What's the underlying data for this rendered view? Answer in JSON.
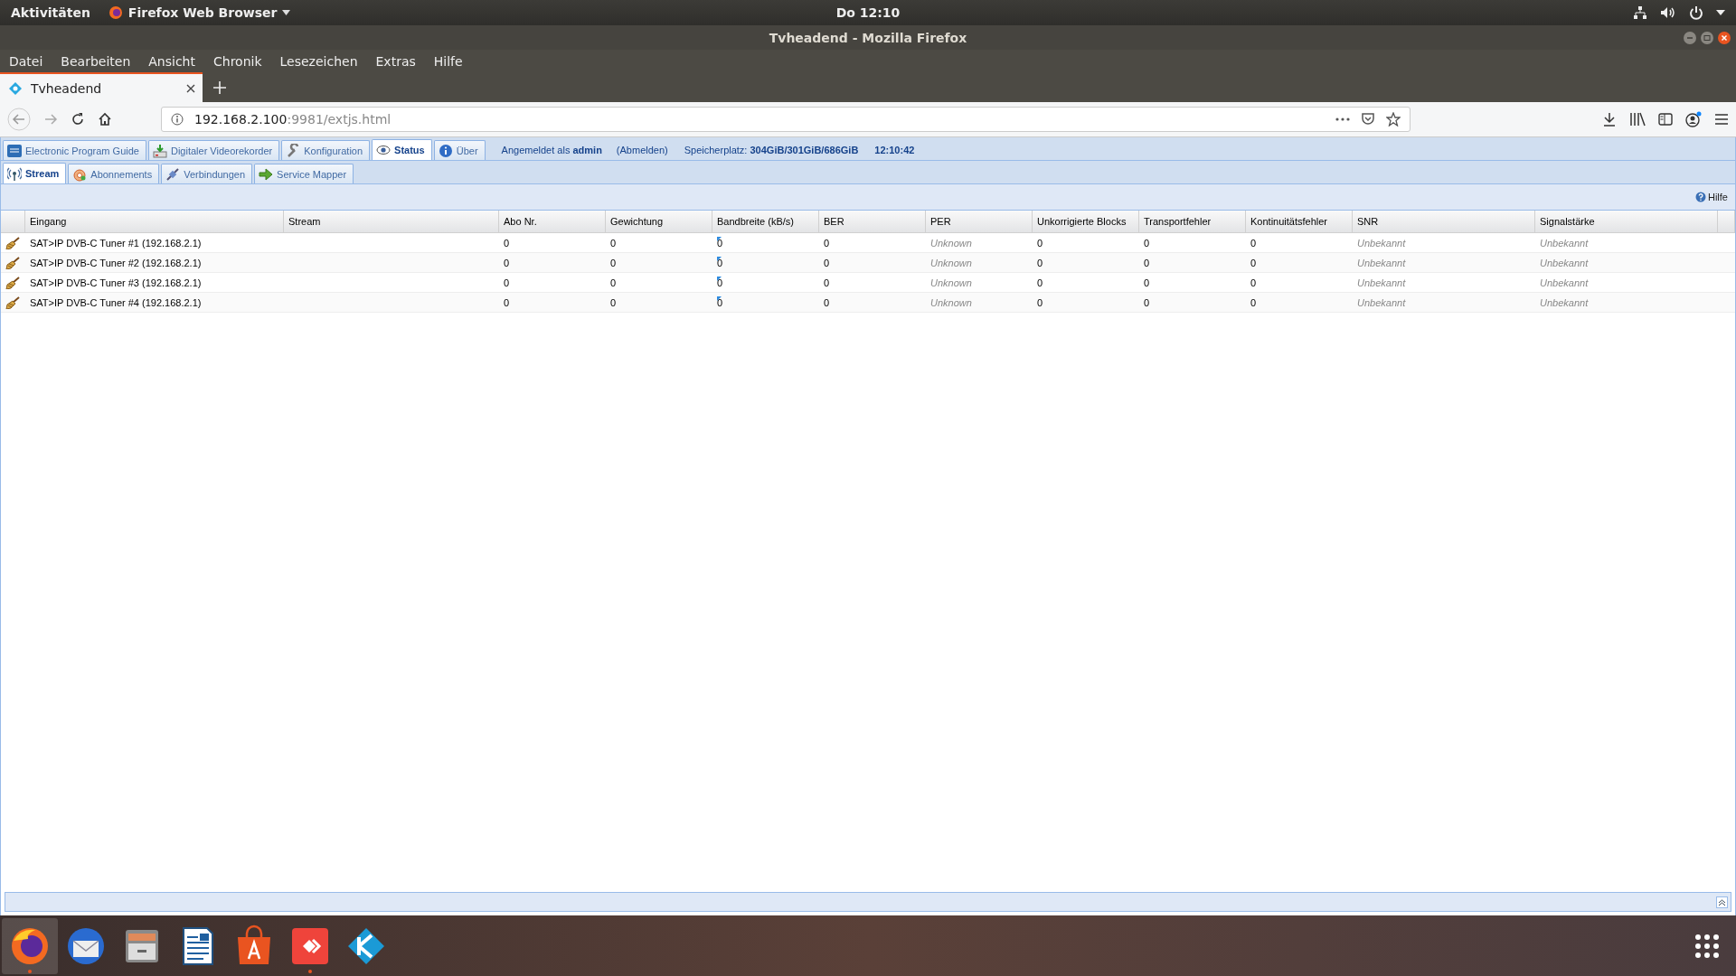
{
  "top_bar": {
    "activities": "Aktivitäten",
    "app_menu": "Firefox Web Browser",
    "clock": "Do 12:10"
  },
  "window": {
    "title": "Tvheadend - Mozilla Firefox"
  },
  "menu": [
    "Datei",
    "Bearbeiten",
    "Ansicht",
    "Chronik",
    "Lesezeichen",
    "Extras",
    "Hilfe"
  ],
  "browser_tabs": [
    {
      "label": "Tvheadend",
      "selected": true
    }
  ],
  "address": {
    "host": "192.168.2.100",
    "rest": ":9981/extjs.html"
  },
  "main_tabs": [
    {
      "label": "Electronic Program Guide",
      "selected": false
    },
    {
      "label": "Digitaler Videorekorder",
      "selected": false
    },
    {
      "label": "Konfiguration",
      "selected": false
    },
    {
      "label": "Status",
      "selected": true
    },
    {
      "label": "Über",
      "selected": false
    }
  ],
  "login": {
    "prefix": "Angemeldet als",
    "user": "admin",
    "logout": "(Abmelden)"
  },
  "storage": {
    "label": "Speicherplatz:",
    "value": "304GiB/301GiB/686GiB"
  },
  "time": "12:10:42",
  "sub_tabs": [
    {
      "label": "Stream",
      "selected": true
    },
    {
      "label": "Abonnements",
      "selected": false
    },
    {
      "label": "Verbindungen",
      "selected": false
    },
    {
      "label": "Service Mapper",
      "selected": false
    }
  ],
  "help": "Hilfe",
  "table": {
    "columns": [
      {
        "label": "Eingang",
        "kind": "plain"
      },
      {
        "label": "Stream",
        "kind": "plain"
      },
      {
        "label": "Abo Nr.",
        "kind": "plain"
      },
      {
        "label": "Gewichtung",
        "kind": "plain"
      },
      {
        "label": "Bandbreite (kB/s)",
        "kind": "rate"
      },
      {
        "label": "BER",
        "kind": "plain"
      },
      {
        "label": "PER",
        "kind": "muted"
      },
      {
        "label": "Unkorrigierte Blocks",
        "kind": "plain"
      },
      {
        "label": "Transportfehler",
        "kind": "plain"
      },
      {
        "label": "Kontinuitätsfehler",
        "kind": "plain"
      },
      {
        "label": "SNR",
        "kind": "muted"
      },
      {
        "label": "Signalstärke",
        "kind": "muted"
      }
    ],
    "rows": [
      [
        "SAT>IP DVB-C Tuner #1 (192.168.2.1)",
        "",
        "0",
        "0",
        "0",
        "0",
        "Unknown",
        "0",
        "0",
        "0",
        "Unbekannt",
        "Unbekannt"
      ],
      [
        "SAT>IP DVB-C Tuner #2 (192.168.2.1)",
        "",
        "0",
        "0",
        "0",
        "0",
        "Unknown",
        "0",
        "0",
        "0",
        "Unbekannt",
        "Unbekannt"
      ],
      [
        "SAT>IP DVB-C Tuner #3 (192.168.2.1)",
        "",
        "0",
        "0",
        "0",
        "0",
        "Unknown",
        "0",
        "0",
        "0",
        "Unbekannt",
        "Unbekannt"
      ],
      [
        "SAT>IP DVB-C Tuner #4 (192.168.2.1)",
        "",
        "0",
        "0",
        "0",
        "0",
        "Unknown",
        "0",
        "0",
        "0",
        "Unbekannt",
        "Unbekannt"
      ]
    ]
  },
  "dock": [
    {
      "kind": "firefox",
      "selected": true,
      "running": true
    },
    {
      "kind": "mail",
      "selected": false,
      "running": false
    },
    {
      "kind": "files",
      "selected": false,
      "running": false
    },
    {
      "kind": "writer",
      "selected": false,
      "running": false
    },
    {
      "kind": "store",
      "selected": false,
      "running": false
    },
    {
      "kind": "anydesk",
      "selected": false,
      "running": true
    },
    {
      "kind": "kodi",
      "selected": false,
      "running": false
    }
  ]
}
